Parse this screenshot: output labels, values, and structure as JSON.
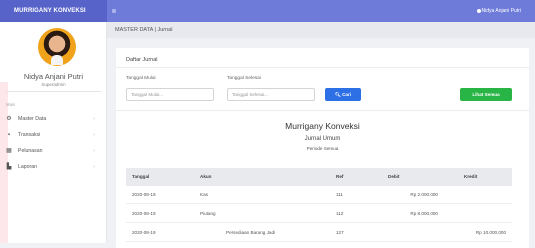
{
  "app": {
    "brand": "MURRIGANY KONVEKSI",
    "user_menu": "Nidya Anjani Putri"
  },
  "profile": {
    "name": "Nidya Anjani Putri",
    "role": "Superadmin"
  },
  "sidebar": {
    "section_label": "Main",
    "items": [
      {
        "label": "Master Data",
        "icon": "gear-icon"
      },
      {
        "label": "Transaksi",
        "icon": "briefcase-icon"
      },
      {
        "label": "Pelunasan",
        "icon": "grid-icon"
      },
      {
        "label": "Laporan",
        "icon": "document-icon"
      }
    ]
  },
  "breadcrumb": "MASTER DATA |   Jurnal",
  "card": {
    "title": "Daftar Jurnal",
    "start_label": "Tanggal Mulai",
    "start_placeholder": "Tanggal Mulai...",
    "end_label": "Tanggal Selesai",
    "end_placeholder": "Tanggal Selesai...",
    "search_button": "Cari",
    "view_all_button": "Lihat Semua"
  },
  "report": {
    "company": "Murrigany Konveksi",
    "title": "Jurnal Umum",
    "period": "Periode Semua"
  },
  "table": {
    "headers": [
      "Tanggal",
      "Akun",
      "Ref",
      "Debit",
      "Kredit"
    ],
    "rows": [
      [
        "2020-08-19",
        "Kas",
        "111",
        "Rp 2.000.000",
        ""
      ],
      [
        "2020-08-19",
        "Piutang",
        "112",
        "Rp 8.000.000",
        ""
      ],
      [
        "2020-08-19",
        "Persediaan Barang Jadi",
        "127",
        "",
        "Rp 10.000.000"
      ]
    ]
  },
  "colors": {
    "topbar": "#6e7bd9",
    "brand": "#5863c9",
    "primary": "#2d6fe4",
    "success": "#28b546"
  }
}
